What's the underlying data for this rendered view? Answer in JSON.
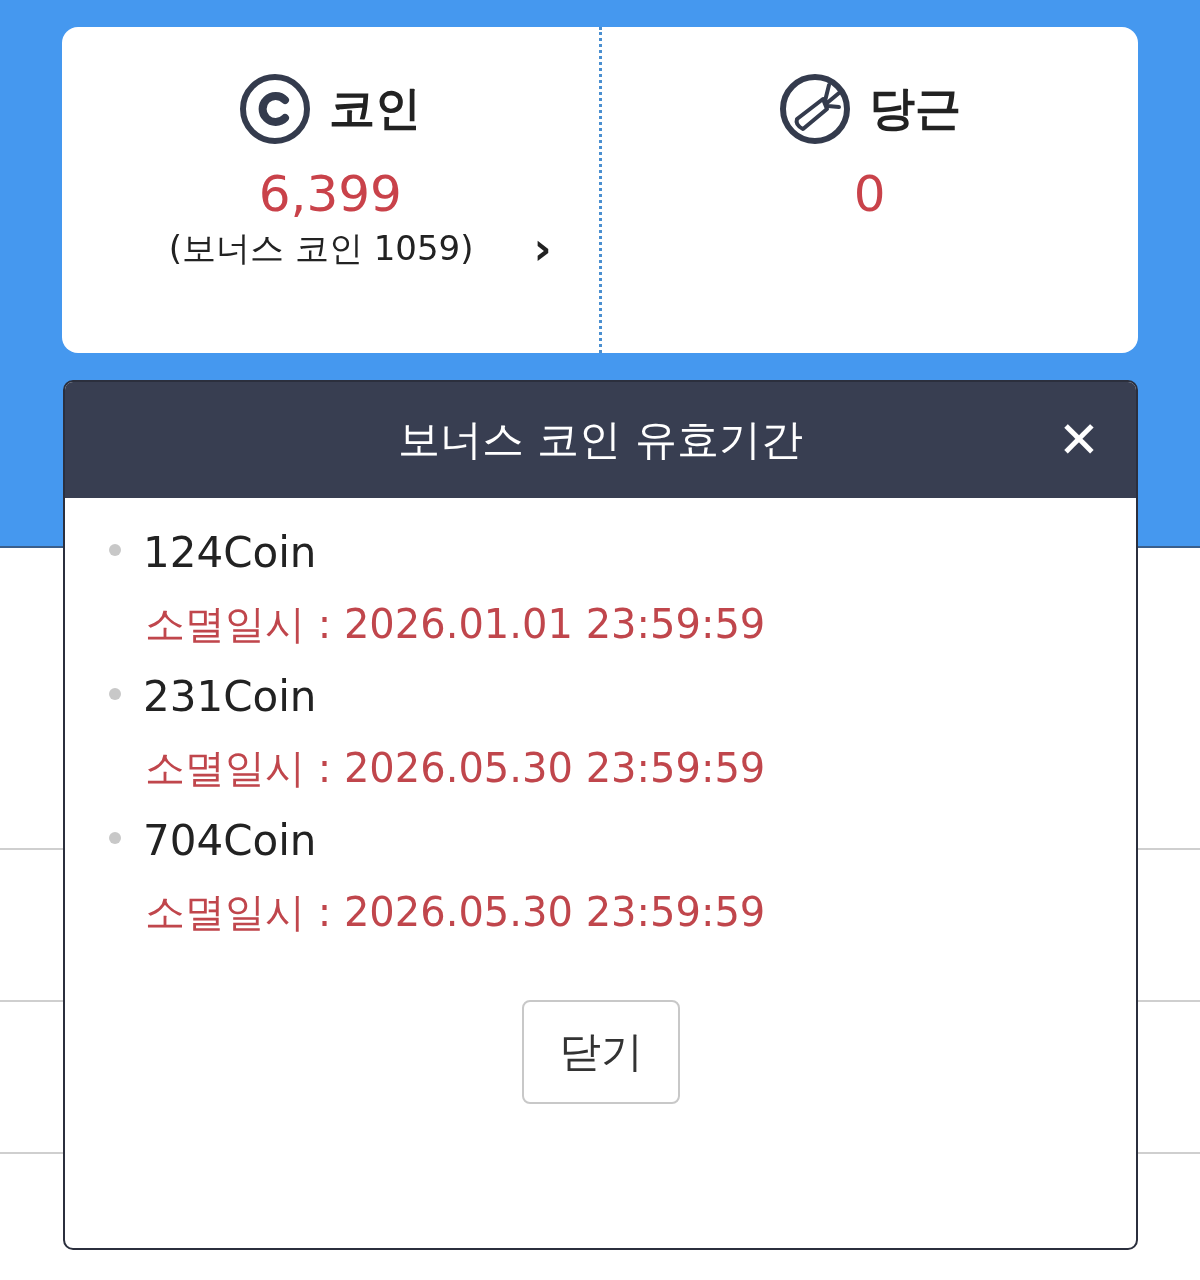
{
  "balances": [
    {
      "kind": "coin",
      "label": "코인",
      "amount": "6,399",
      "bonus": "(보너스 코인 1059)",
      "arrow": "›"
    },
    {
      "kind": "carrot",
      "label": "당근",
      "amount": "0"
    }
  ],
  "dialog": {
    "title": "보너스 코인 유효기간",
    "close": "✕",
    "items": [
      {
        "amount": "124Coin",
        "expiry": "소멸일시 : 2026.01.01 23:59:59"
      },
      {
        "amount": "231Coin",
        "expiry": "소멸일시 : 2026.05.30 23:59:59"
      },
      {
        "amount": "704Coin",
        "expiry": "소멸일시 : 2026.05.30 23:59:59"
      }
    ],
    "button": "닫기"
  }
}
